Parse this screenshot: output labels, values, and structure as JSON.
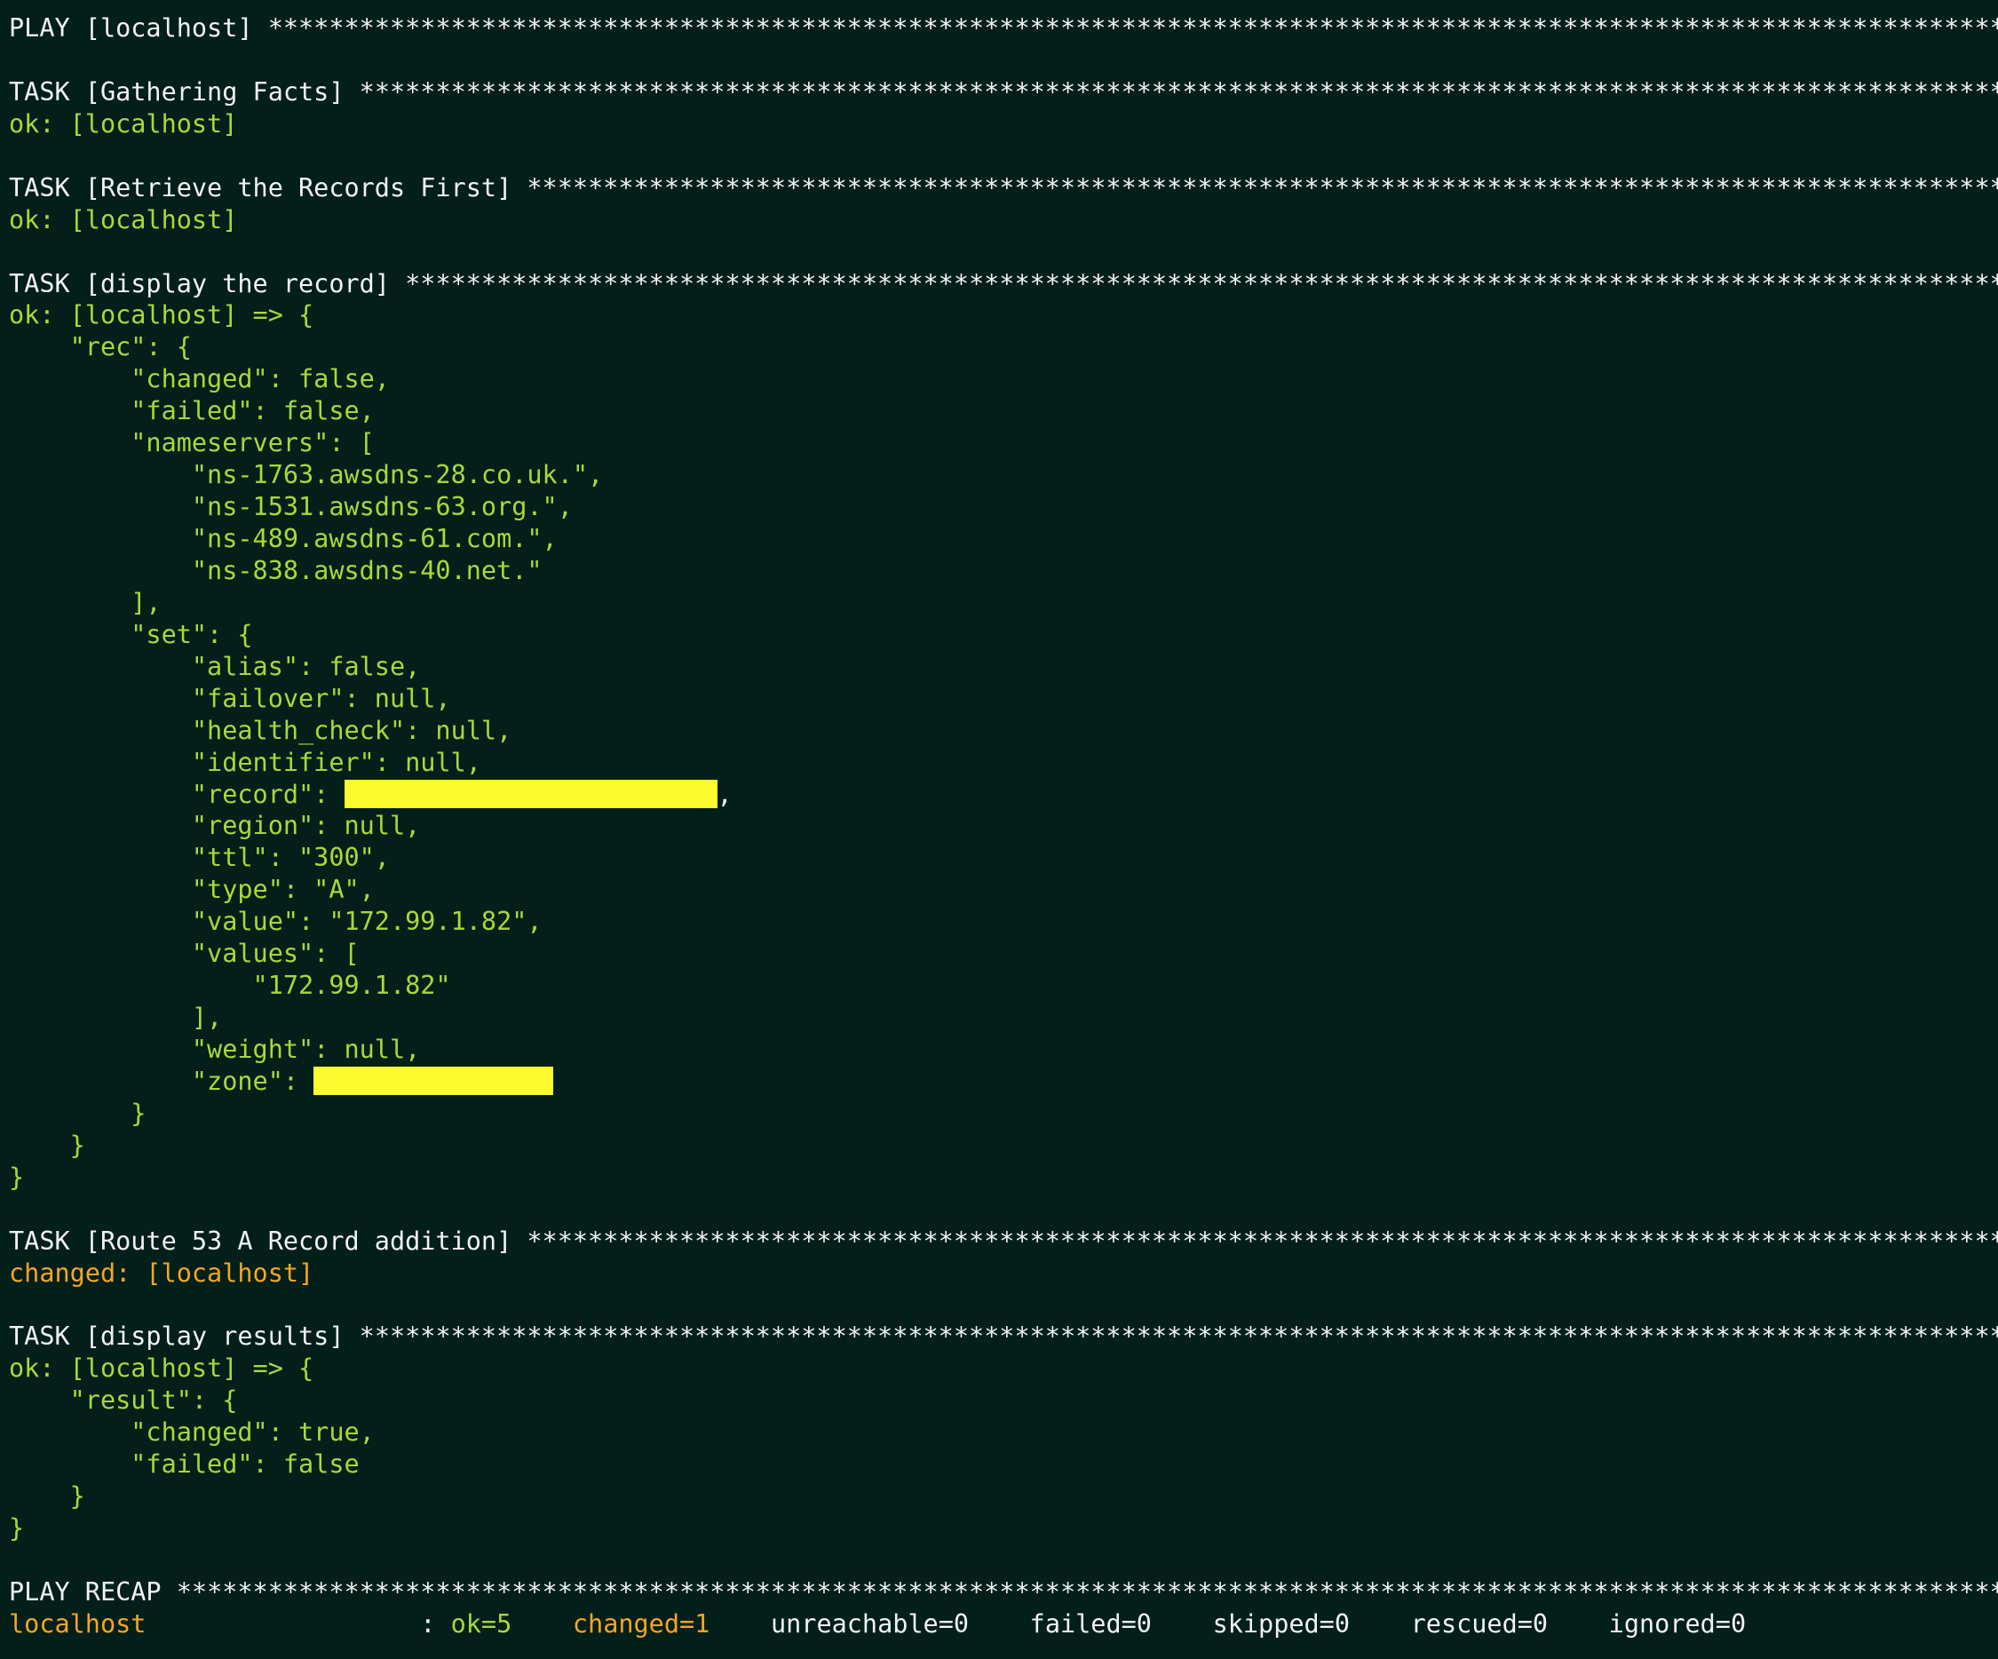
{
  "colors": {
    "background": "#031f1a",
    "header_text": "#f2f2f2",
    "ok_text": "#a8d93a",
    "changed_text": "#f5a623",
    "redaction": "#fbfb2e"
  },
  "stars": "****************************************************************************************************************************************************************",
  "play": {
    "header": "PLAY [localhost] "
  },
  "tasks": {
    "gathering_facts": {
      "header": "TASK [Gathering Facts] ",
      "status": "ok: [localhost]"
    },
    "retrieve_records": {
      "header": "TASK [Retrieve the Records First] ",
      "status": "ok: [localhost]"
    },
    "display_record": {
      "header": "TASK [display the record] ",
      "output": {
        "open": "ok: [localhost] => {",
        "rec_open": "    \"rec\": {",
        "changed": "        \"changed\": false,",
        "failed": "        \"failed\": false,",
        "nameservers_open": "        \"nameservers\": [",
        "ns1": "            \"ns-1763.awsdns-28.co.uk.\",",
        "ns2": "            \"ns-1531.awsdns-63.org.\",",
        "ns3": "            \"ns-489.awsdns-61.com.\",",
        "ns4": "            \"ns-838.awsdns-40.net.\"",
        "nameservers_close": "        ],",
        "set_open": "        \"set\": {",
        "alias": "            \"alias\": false,",
        "failover": "            \"failover\": null,",
        "health_check": "            \"health_check\": null,",
        "identifier": "            \"identifier\": null,",
        "record_key": "            \"record\": ",
        "record_tail": ",",
        "region": "            \"region\": null,",
        "ttl": "            \"ttl\": \"300\",",
        "type": "            \"type\": \"A\",",
        "value": "            \"value\": \"172.99.1.82\",",
        "values_open": "            \"values\": [",
        "values_item": "                \"172.99.1.82\"",
        "values_close": "            ],",
        "weight": "            \"weight\": null,",
        "zone_key": "            \"zone\": ",
        "set_close": "        }",
        "rec_close": "    }",
        "close": "}"
      }
    },
    "route53_add": {
      "header": "TASK [Route 53 A Record addition] ",
      "status": "changed: [localhost]"
    },
    "display_results": {
      "header": "TASK [display results] ",
      "output": {
        "open": "ok: [localhost] => {",
        "result_open": "    \"result\": {",
        "changed": "        \"changed\": true,",
        "failed": "        \"failed\": false",
        "result_close": "    }",
        "close": "}"
      }
    }
  },
  "recap": {
    "header": "PLAY RECAP ",
    "host": "localhost                  ",
    "colon": ": ",
    "ok": "ok=5",
    "gap1": "    ",
    "changed": "changed=1",
    "gap2": "    ",
    "rest": "unreachable=0    failed=0    skipped=0    rescued=0    ignored=0"
  }
}
